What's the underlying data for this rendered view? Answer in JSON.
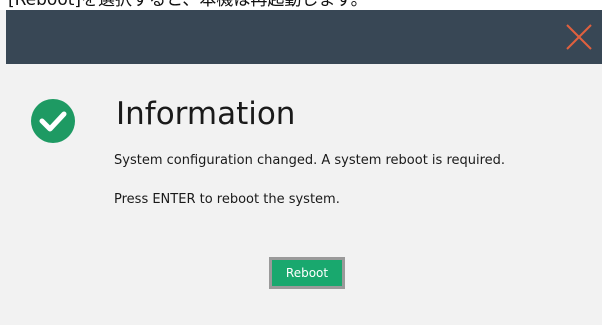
{
  "caption": {
    "text": "[Reboot]を選択すると、本機は再起動します。"
  },
  "titlebar": {
    "close_icon": "close-icon",
    "close_color": "#e0603e",
    "background": "#384755"
  },
  "dialog": {
    "icon": "check-circle-icon",
    "icon_color": "#1e9a63",
    "title": "Information",
    "message_1": "System configuration changed. A system reboot is required.",
    "message_2": "Press ENTER to reboot the system.",
    "reboot_label": "Reboot",
    "reboot_color": "#19a86e"
  }
}
